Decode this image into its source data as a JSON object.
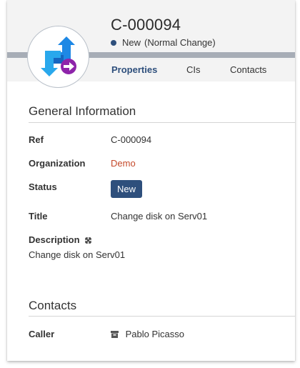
{
  "header": {
    "title": "C-000094",
    "status": "New",
    "status_detail": "(Normal Change)",
    "status_color": "#2e4f7c",
    "logo_icon": "change-request-icon"
  },
  "tabs": [
    {
      "label": "Properties",
      "active": true
    },
    {
      "label": "CIs",
      "active": false
    },
    {
      "label": "Contacts",
      "active": false
    }
  ],
  "general": {
    "section_title": "General Information",
    "ref_label": "Ref",
    "ref_value": "C-000094",
    "org_label": "Organization",
    "org_value": "Demo",
    "status_label": "Status",
    "status_value": "New",
    "title_label": "Title",
    "title_value": "Change disk on Serv01",
    "description_label": "Description",
    "description_value": "Change disk on Serv01"
  },
  "contacts": {
    "section_title": "Contacts",
    "caller_label": "Caller",
    "caller_value": "Pablo Picasso",
    "caller_icon": "person-card-icon"
  },
  "colors": {
    "accent": "#2e4f7c",
    "link": "#c5492a",
    "logo_blue": "#1e88e5",
    "logo_purple": "#8e24aa"
  }
}
